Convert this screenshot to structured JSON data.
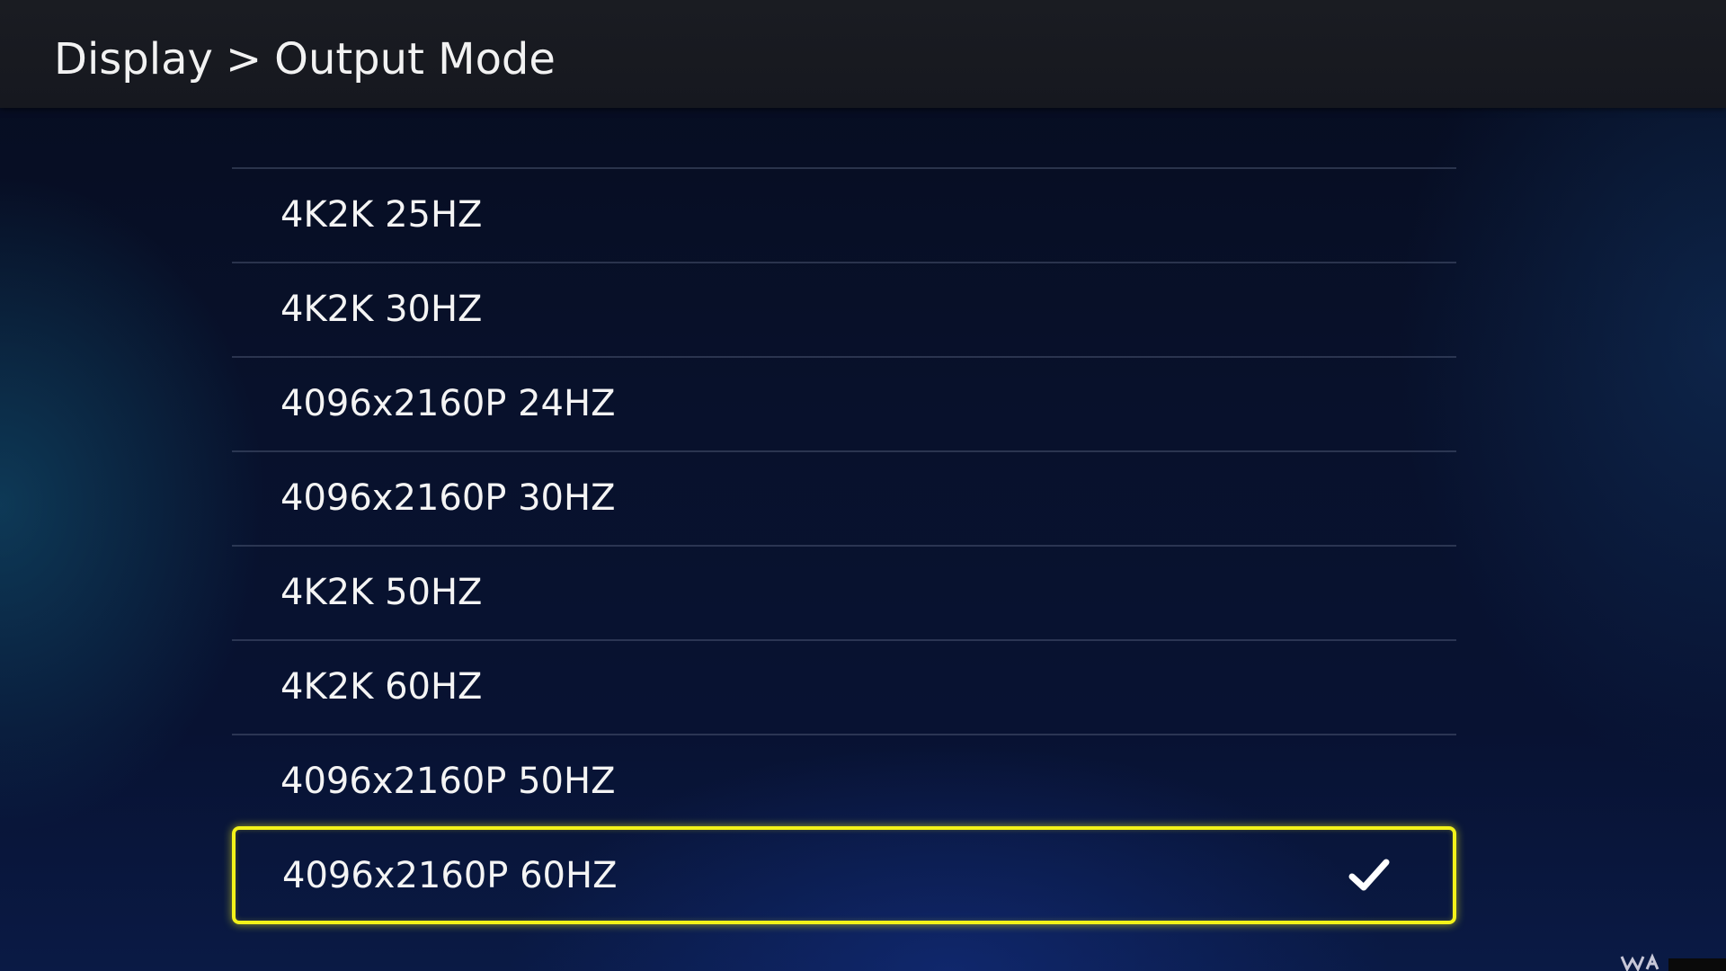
{
  "header": {
    "breadcrumb": [
      "Display",
      "Output Mode"
    ],
    "separator": ">"
  },
  "output_modes": [
    {
      "label": "4K2K 25HZ",
      "selected": false
    },
    {
      "label": "4K2K 30HZ",
      "selected": false
    },
    {
      "label": "4096x2160P 24HZ",
      "selected": false
    },
    {
      "label": "4096x2160P 30HZ",
      "selected": false
    },
    {
      "label": "4K2K 50HZ",
      "selected": false
    },
    {
      "label": "4K2K 60HZ",
      "selected": false
    },
    {
      "label": "4096x2160P 50HZ",
      "selected": false
    },
    {
      "label": "4096x2160P 60HZ",
      "selected": true
    }
  ],
  "icons": {
    "selected_marker": "checkmark-icon"
  },
  "colors": {
    "focus_border": "#f2f21a",
    "text": "#f4f4f4",
    "header_bg": "#1a1c22"
  }
}
